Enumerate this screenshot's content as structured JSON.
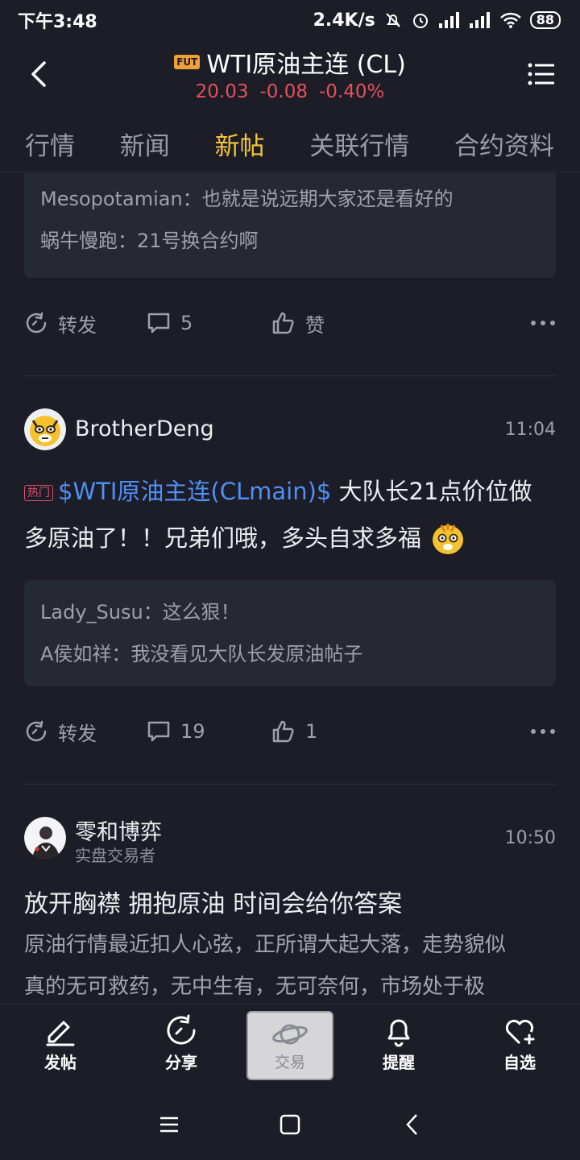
{
  "status_bar": {
    "time": "下午3:48",
    "net_speed": "2.4K/s",
    "battery": "88"
  },
  "header": {
    "badge": "FUT",
    "title": "WTI原油主连 (CL)",
    "price": "20.03",
    "change": "-0.08",
    "change_pct": "-0.40%"
  },
  "tabs": [
    {
      "label": "行情"
    },
    {
      "label": "新闻"
    },
    {
      "label": "新帖"
    },
    {
      "label": "关联行情"
    },
    {
      "label": "合约资料"
    }
  ],
  "feed": {
    "post1": {
      "comments": [
        {
          "user": "Mesopotamian",
          "text": "：也就是说远期大家还是看好的"
        },
        {
          "user": "蜗牛慢跑",
          "text": "：21号换合约啊"
        }
      ],
      "repost_label": "转发",
      "comment_count": "5",
      "like_label": "赞"
    },
    "post2": {
      "username": "BrotherDeng",
      "time": "11:04",
      "hot_badge": "热门",
      "stock_tag": "$WTI原油主连(CLmain)$",
      "text_line1": " 大队长21点价位做",
      "text_line2": "多原油了！！兄弟们哦，多头自求多福",
      "comments": [
        {
          "user": "Lady_Susu",
          "text": "：这么狠！"
        },
        {
          "user": "A侯如祥",
          "text": "：我没看见大队长发原油帖子"
        }
      ],
      "repost_label": "转发",
      "comment_count": "19",
      "like_count": "1"
    },
    "post3": {
      "username": "零和博弈",
      "subtitle": "实盘交易者",
      "time": "10:50",
      "title": "放开胸襟 拥抱原油 时间会给你答案",
      "excerpt_line1": "原油行情最近扣人心弦，正所谓大起大落，走势貌似",
      "excerpt_line2": "真的无可救药，无中生有，无可奈何，市场处于极"
    }
  },
  "bottom_bar": {
    "post": "发帖",
    "share": "分享",
    "trade": "交易",
    "remind": "提醒",
    "watchlist": "自选"
  },
  "colors": {
    "background": "#1c1d26",
    "accent_yellow": "#f6c637",
    "down_red": "#e64f5a",
    "link_blue": "#4f8ff6"
  }
}
